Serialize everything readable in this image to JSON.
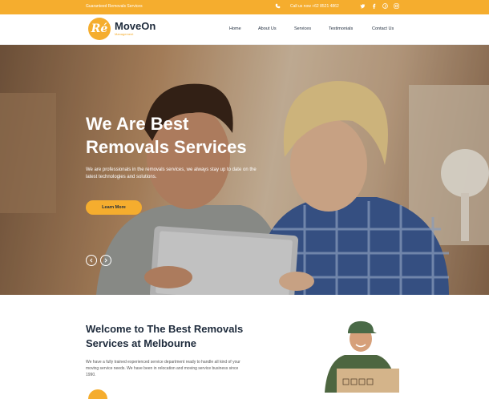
{
  "topbar": {
    "tagline": "Guaranteed Removals Services",
    "phone": "Call us now +62 8521 4862",
    "social_icons": [
      "twitter-icon",
      "facebook-icon",
      "pinterest-icon",
      "instagram-icon"
    ]
  },
  "header": {
    "logo_mark": "Ré",
    "logo_name": "MoveOn",
    "logo_sub": "Management",
    "nav": [
      "Home",
      "About Us",
      "Services",
      "Testimonials",
      "Contact Us"
    ]
  },
  "hero": {
    "title_line1": "We Are Best",
    "title_line2": "Removals Services",
    "description": "We are professionals in the removals services, we always stay up to date on the latest technologies and solutions.",
    "cta": "Learn More"
  },
  "welcome": {
    "title": "Welcome to The Best Removals Services at Melbourne",
    "text": "We have a fully trained experienced service department ready to handle all kind of your moving service needs. We have been in relocation and moving service business since 1990."
  },
  "colors": {
    "accent": "#f5ad2e",
    "navy": "#1d2a3b"
  }
}
